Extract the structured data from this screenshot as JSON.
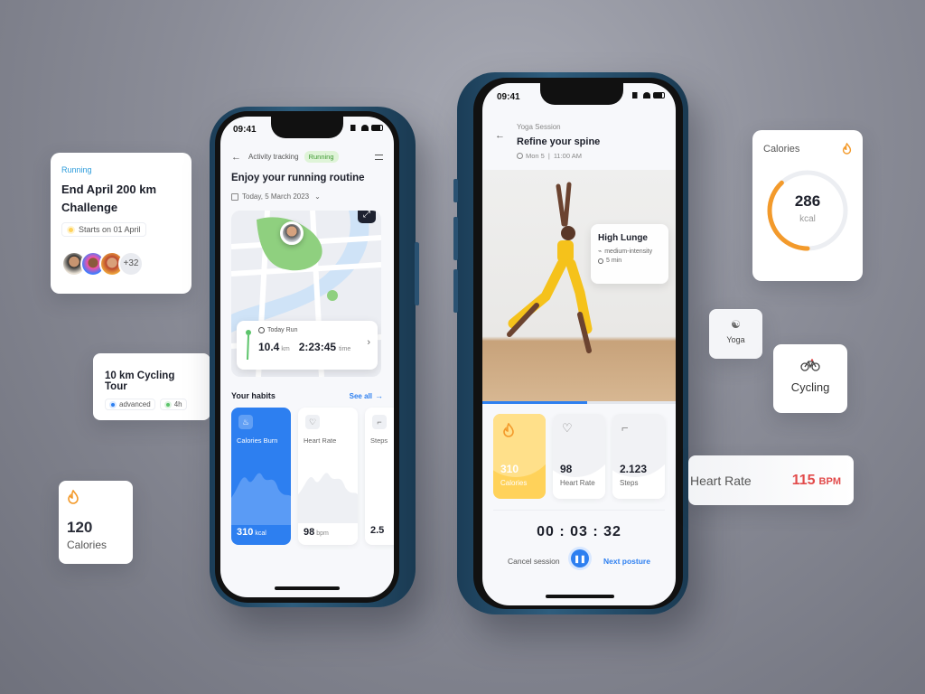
{
  "challenge_card": {
    "category": "Running",
    "title_line1": "End April 200 km",
    "title_line2": "Challenge",
    "start_badge": "Starts on 01 April",
    "participants_extra": "+32"
  },
  "cycling_tour_card": {
    "title": "10 km Cycling Tour",
    "level": "advanced",
    "duration": "4h"
  },
  "calories_small_card": {
    "value": "120",
    "label": "Calories"
  },
  "phone1": {
    "time": "09:41",
    "header_title": "Activity tracking",
    "header_badge": "Running",
    "headline": "Enjoy your running routine",
    "date": "Today, 5 March 2023",
    "today_run": {
      "label": "Today Run",
      "distance": "10.4",
      "distance_unit": "km",
      "duration": "2:23:45",
      "duration_unit": "time"
    },
    "habits_title": "Your habits",
    "see_all": "See all",
    "habits": [
      {
        "label": "Calories Burn",
        "value": "310",
        "unit": "kcal"
      },
      {
        "label": "Heart Rate",
        "value": "98",
        "unit": "bpm"
      },
      {
        "label": "Steps",
        "value": "2.5"
      }
    ]
  },
  "phone2": {
    "time": "09:41",
    "session_type": "Yoga Session",
    "session_title": "Refine your spine",
    "session_day": "Mon 5",
    "session_time": "11:00 AM",
    "pose_card": {
      "title": "High Lunge",
      "intensity": "medium-intensity",
      "duration": "5 min"
    },
    "progress": 0.54,
    "stats": [
      {
        "value": "310",
        "label": "Calories"
      },
      {
        "value": "98",
        "label": "Heart Rate"
      },
      {
        "value": "2.123",
        "label": "Steps"
      }
    ],
    "timer": "00 : 03 : 32",
    "cancel_label": "Cancel session",
    "next_label": "Next posture"
  },
  "calories_ring_card": {
    "title": "Calories",
    "value": "286",
    "unit": "kcal",
    "ring_fraction": 0.38
  },
  "yoga_chip": {
    "label": "Yoga"
  },
  "cycling_chip": {
    "label": "Cycling"
  },
  "heart_rate_card": {
    "label": "Heart Rate",
    "value": "115",
    "unit": "BPM"
  },
  "colors": {
    "accent_blue": "#2d7ff0",
    "orange": "#f39a2b",
    "yellow": "#ffd25a",
    "red": "#e24b4b",
    "green": "#5cc46b"
  }
}
